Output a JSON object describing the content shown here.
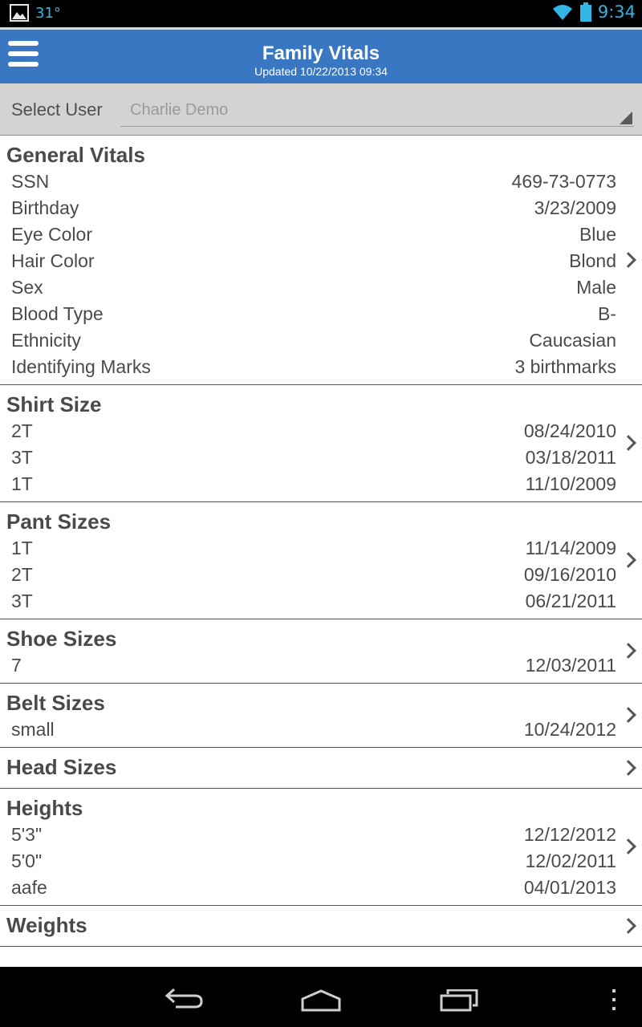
{
  "status": {
    "temperature": "31°",
    "time": "9:34"
  },
  "header": {
    "title": "Family Vitals",
    "subtitle": "Updated 10/22/2013 09:34"
  },
  "select_user": {
    "label": "Select User",
    "value": "Charlie Demo"
  },
  "sections": [
    {
      "title": "General Vitals",
      "rows": [
        {
          "label": "SSN",
          "value": "469-73-0773"
        },
        {
          "label": "Birthday",
          "value": "3/23/2009"
        },
        {
          "label": "Eye Color",
          "value": "Blue"
        },
        {
          "label": "Hair Color",
          "value": "Blond"
        },
        {
          "label": "Sex",
          "value": "Male"
        },
        {
          "label": "Blood Type",
          "value": "B-"
        },
        {
          "label": "Ethnicity",
          "value": "Caucasian"
        },
        {
          "label": "Identifying Marks",
          "value": "3 birthmarks"
        }
      ]
    },
    {
      "title": "Shirt Size",
      "rows": [
        {
          "label": "2T",
          "value": "08/24/2010"
        },
        {
          "label": "3T",
          "value": "03/18/2011"
        },
        {
          "label": "1T",
          "value": "11/10/2009"
        }
      ]
    },
    {
      "title": "Pant Sizes",
      "rows": [
        {
          "label": "1T",
          "value": "11/14/2009"
        },
        {
          "label": "2T",
          "value": "09/16/2010"
        },
        {
          "label": "3T",
          "value": "06/21/2011"
        }
      ]
    },
    {
      "title": "Shoe Sizes",
      "rows": [
        {
          "label": "7",
          "value": "12/03/2011"
        }
      ]
    },
    {
      "title": "Belt Sizes",
      "rows": [
        {
          "label": "small",
          "value": "10/24/2012"
        }
      ]
    },
    {
      "title": "Head Sizes",
      "rows": []
    },
    {
      "title": "Heights",
      "rows": [
        {
          "label": "5'3\"",
          "value": "12/12/2012"
        },
        {
          "label": "5'0\"",
          "value": "12/02/2011"
        },
        {
          "label": "aafe",
          "value": "04/01/2013"
        }
      ]
    },
    {
      "title": "Weights",
      "rows": []
    }
  ],
  "icons": {
    "menu": "hamburger-menu-icon",
    "chevron": "chevron-right-icon",
    "nav_back": "back-icon",
    "nav_home": "home-icon",
    "nav_recents": "recents-icon",
    "nav_overflow": "overflow-menu-icon"
  },
  "colors": {
    "action_bar": "#3a77c2",
    "status_text": "#33b5e5",
    "select_bg": "#d3d3d3"
  }
}
